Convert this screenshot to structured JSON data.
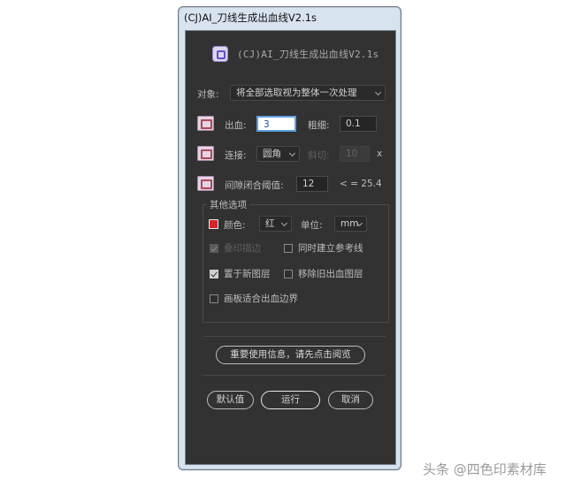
{
  "window": {
    "title": "(CJ)AI_刀线生成出血线V2.1s"
  },
  "app": {
    "title": "(CJ)AI_刀线生成出血线V2.1s"
  },
  "object_row": {
    "label": "对象:",
    "value": "将全部选取视为整体一次处理"
  },
  "bleed_row": {
    "label": "出血:",
    "value": "3",
    "thickness_label": "粗细:",
    "thickness_value": "0.1"
  },
  "connect_row": {
    "label": "连接:",
    "value": "圆角",
    "angle_label": "斜切:",
    "angle_value": "10",
    "angle_unit": "x"
  },
  "gap_row": {
    "label": "间隙闭合阈值:",
    "value": "12",
    "note": "< = 25.4"
  },
  "other": {
    "legend": "其他选项",
    "color_label": "颜色:",
    "color_value": "红",
    "unit_label": "单位:",
    "unit_value": "mm",
    "opt_overprint": "叠印描边",
    "opt_guide": "同时建立参考线",
    "opt_new_layer": "置于新图层",
    "opt_remove_old": "移除旧出血图层",
    "opt_artboard": "画板适合出血边界",
    "swatch_color": "#d6262b"
  },
  "buttons": {
    "info": "重要使用信息，请先点击阅览",
    "default": "默认值",
    "run": "运行",
    "cancel": "取消"
  },
  "watermark": "头条 @四色印素材库"
}
